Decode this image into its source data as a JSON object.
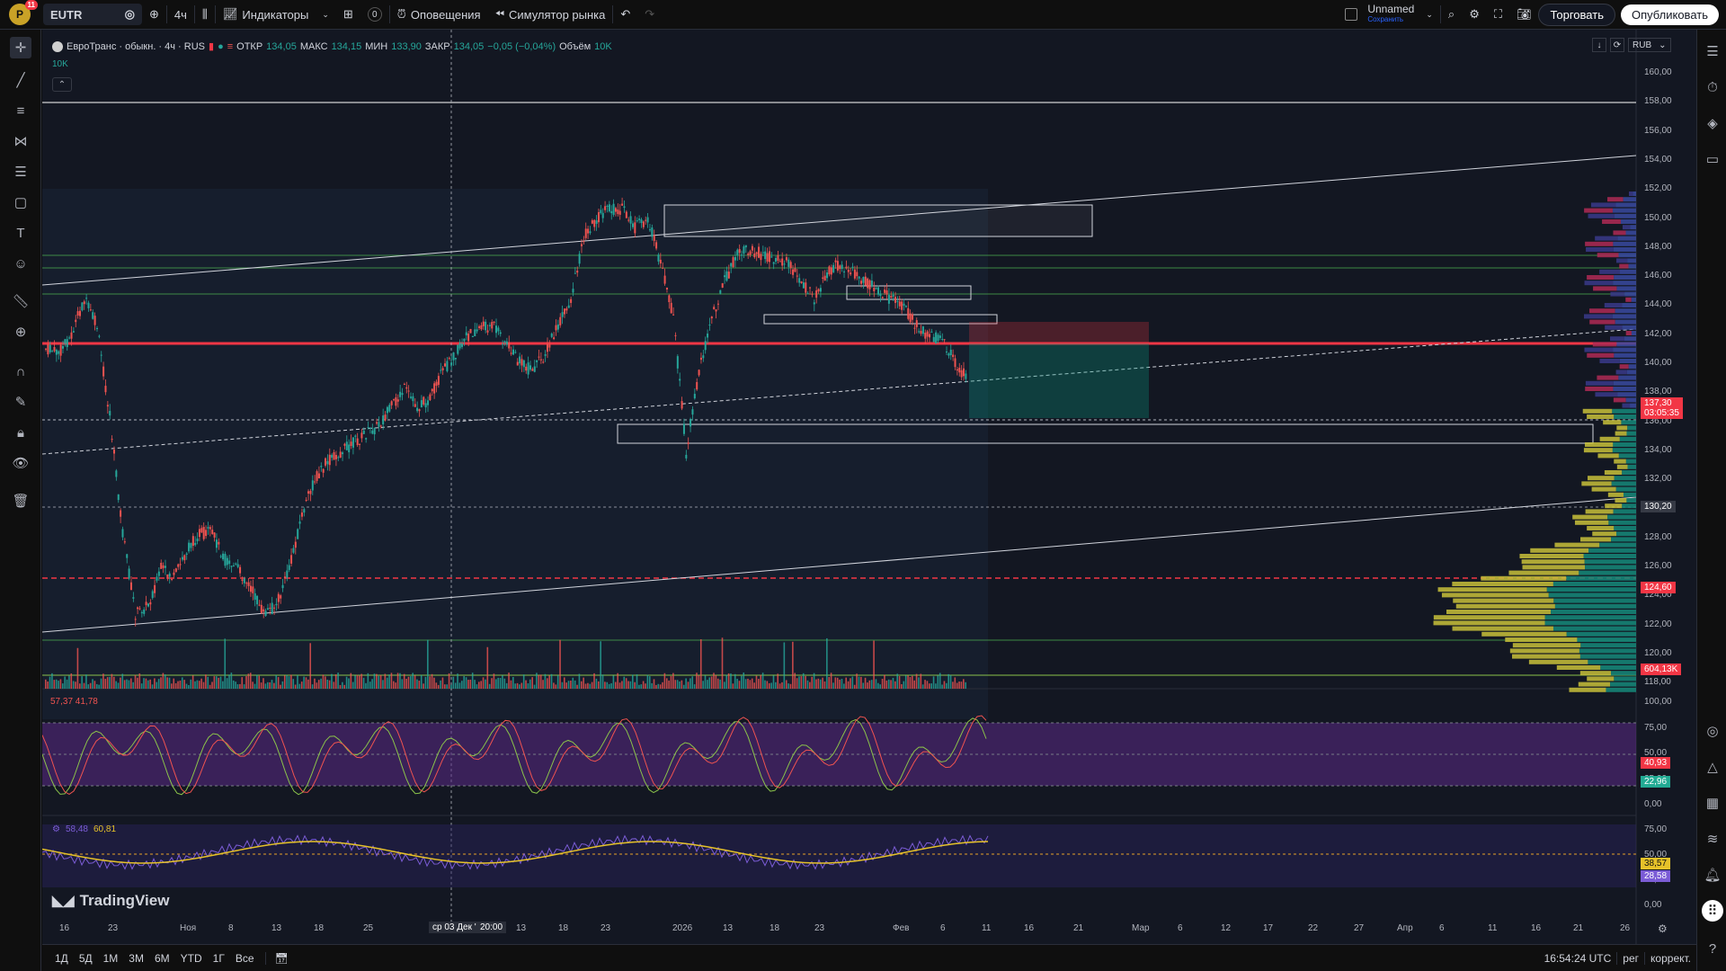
{
  "topbar": {
    "notif_count": "11",
    "avatar_letter": "P",
    "symbol": "EUTR",
    "interval": "4ч",
    "indicators_label": "Индикаторы",
    "alerts_label": "Оповещения",
    "replay_label": "Симулятор рынка",
    "layout_count": "0",
    "layout_name": "Unnamed",
    "layout_saved": "Сохранить",
    "trade_label": "Торговать",
    "publish_label": "Опубликовать"
  },
  "legend": {
    "title": "ЕвроТранс · обыкн. · 4ч · RUS",
    "open_label": "ОТКР",
    "open": "134,05",
    "high_label": "МАКС",
    "high": "134,15",
    "low_label": "МИН",
    "low": "133,90",
    "close_label": "ЗАКР",
    "close": "134,05",
    "change": "−0,05 (−0,04%)",
    "volume_label": "Объём",
    "volume": "10K",
    "volume_sub": "10K",
    "currency": "RUB"
  },
  "price_axis": [
    "160,00",
    "158,00",
    "156,00",
    "154,00",
    "152,00",
    "150,00",
    "148,00",
    "146,00",
    "144,00",
    "142,00",
    "140,00",
    "138,00",
    "136,00",
    "134,00",
    "132,00",
    "130,00",
    "128,00",
    "126,00",
    "124,00",
    "122,00",
    "120,00",
    "118,00"
  ],
  "price_tags": {
    "last": "137,30",
    "countdown": "03:05:35",
    "crosshair": "130,20",
    "level": "124,60",
    "volume": "604,13K"
  },
  "osc1": {
    "values": "57,37  41,78",
    "axis": [
      "100,00",
      "75,00",
      "50,00",
      "25,00",
      "0,00"
    ],
    "tag_red": "40,93",
    "tag_green": "22,96"
  },
  "osc2": {
    "values": "58,48",
    "value2": "60,81",
    "axis": [
      "75,00",
      "50,00",
      "25,00",
      "0,00"
    ],
    "tag_yellow": "38,57",
    "tag_purple": "28,58"
  },
  "time_axis": [
    "16",
    "23",
    "Ноя",
    "8",
    "13",
    "18",
    "25",
    "ср 03 Дек '25",
    "20:00",
    "13",
    "18",
    "23",
    "2026",
    "13",
    "18",
    "23",
    "Фев",
    "6",
    "11",
    "16",
    "21",
    "Мар",
    "6",
    "12",
    "17",
    "22",
    "27",
    "Апр",
    "6",
    "11",
    "16",
    "21",
    "26"
  ],
  "brand": "TradingView",
  "bottombar": {
    "ranges": [
      "1Д",
      "5Д",
      "1М",
      "3М",
      "6М",
      "YTD",
      "1Г",
      "Все"
    ],
    "clock": "16:54:24 UTC",
    "mode": "рег",
    "adjust": "коррект."
  },
  "colors": {
    "up": "#26a69a",
    "down": "#ef5350",
    "bg": "#131722",
    "accent_red": "#f23645",
    "volume_profile_yellow": "#c9c13a",
    "volume_profile_teal": "#16897a",
    "osc_purple": "#5b2a86",
    "osc2_line": "#e6c229",
    "osc2_line2": "#7b5cd6"
  }
}
